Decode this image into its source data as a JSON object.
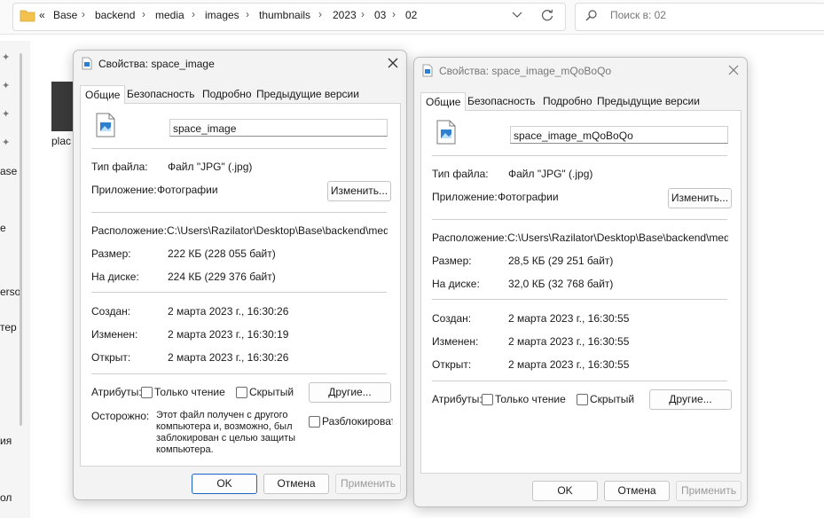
{
  "explorer": {
    "breadcrumbs": [
      "Base",
      "backend",
      "media",
      "images",
      "thumbnails",
      "2023",
      "03",
      "02"
    ],
    "back_chevrons": "«",
    "search_placeholder": "Поиск в: 02",
    "sidebar_fragments": [
      "ase",
      "e",
      "erso",
      "тер",
      "ия",
      "ол"
    ],
    "thumbnail_label": "plac"
  },
  "tabs": [
    "Общие",
    "Безопасность",
    "Подробно",
    "Предыдущие версии"
  ],
  "labels": {
    "file_type": "Тип файла:",
    "app": "Приложение:",
    "location": "Расположение:",
    "size": "Размер:",
    "disk": "На диске:",
    "created": "Создан:",
    "modified": "Изменен:",
    "opened": "Открыт:",
    "attributes": "Атрибуты:",
    "readonly": "Только чтение",
    "hidden": "Скрытый",
    "warning": "Осторожно:",
    "unblock": "Разблокировать"
  },
  "buttons": {
    "change": "Изменить...",
    "other": "Другие...",
    "ok": "OK",
    "cancel": "Отмена",
    "apply": "Применить"
  },
  "dialog1": {
    "title": "Свойства: space_image",
    "filename": "space_image",
    "file_type": "Файл \"JPG\" (.jpg)",
    "app": "Фотографии",
    "location": "C:\\Users\\Razilator\\Desktop\\Base\\backend\\media\\i",
    "size": "222 КБ (228 055 байт)",
    "disk": "224 КБ (229 376 байт)",
    "created": "2 марта 2023 г., 16:30:26",
    "modified": "2 марта 2023 г., 16:30:19",
    "opened": "2 марта 2023 г., 16:30:26",
    "warning_lines": [
      "Этот файл получен с другого",
      "компьютера и, возможно, был",
      "заблокирован с целью защиты",
      "компьютера."
    ]
  },
  "dialog2": {
    "title": "Свойства: space_image_mQoBoQo",
    "filename": "space_image_mQoBoQo",
    "file_type": "Файл \"JPG\" (.jpg)",
    "app": "Фотографии",
    "location": "C:\\Users\\Razilator\\Desktop\\Base\\backend\\media\\i",
    "size": "28,5 КБ (29 251 байт)",
    "disk": "32,0 КБ (32 768 байт)",
    "created": "2 марта 2023 г., 16:30:55",
    "modified": "2 марта 2023 г., 16:30:55",
    "opened": "2 марта 2023 г., 16:30:55"
  },
  "colors": {
    "accent": "#1a64c8",
    "dialog_bg": "#f3f3f3",
    "panel_bg": "#ffffff"
  }
}
